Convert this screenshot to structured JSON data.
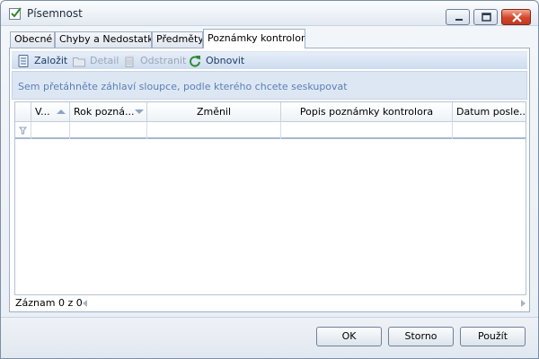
{
  "window": {
    "title": "Písemnost"
  },
  "tabs": [
    {
      "label": "Obecné",
      "active": false
    },
    {
      "label": "Chyby a Nedostatky",
      "active": false
    },
    {
      "label": "Předměty",
      "active": false
    },
    {
      "label": "Poznámky kontrolora",
      "active": true
    }
  ],
  "toolbar": {
    "create_label": "Založit",
    "detail_label": "Detail",
    "remove_label": "Odstranit",
    "refresh_label": "Obnovit"
  },
  "grid": {
    "group_hint": "Sem přetáhněte záhlaví sloupce, podle kterého chcete seskupovat",
    "columns": [
      {
        "label": "V...",
        "sort": "asc"
      },
      {
        "label": "Rok pozná...",
        "sort": "desc"
      },
      {
        "label": "Změnil",
        "sort": ""
      },
      {
        "label": "Popis poznámky kontrolora",
        "sort": ""
      },
      {
        "label": "Datum posle...",
        "sort": ""
      }
    ],
    "rows": [],
    "record_count": "Záznam 0 z 0"
  },
  "buttons": {
    "ok_label": "OK",
    "cancel_label": "Storno",
    "apply_label": "Použít"
  },
  "colors": {
    "accent": "#1f3b66",
    "group_hint": "#5a7fb5",
    "close_button": "#d3452b"
  }
}
